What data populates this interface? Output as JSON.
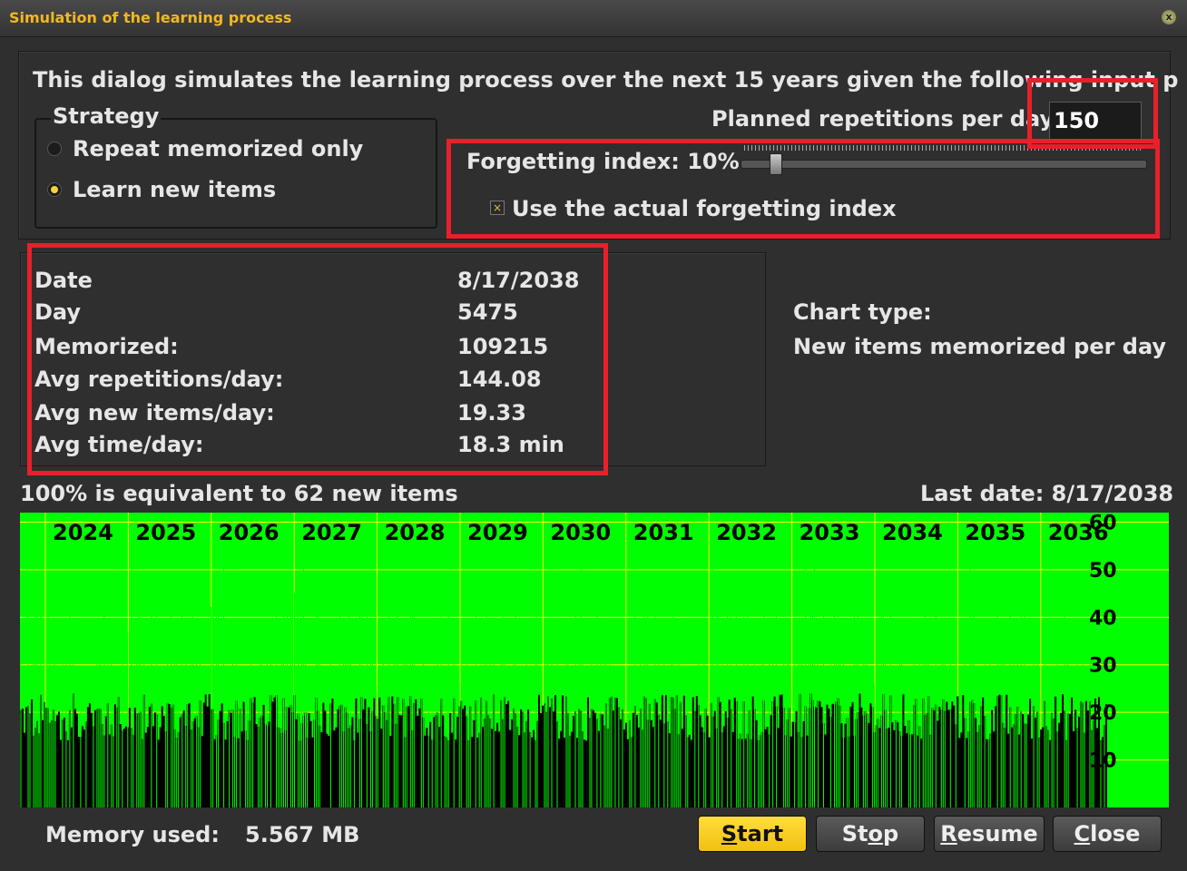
{
  "window": {
    "title": "Simulation of the learning process",
    "close_glyph": "x"
  },
  "intro_text": "This dialog simulates the learning process over the next 15 years given the following input paramete",
  "strategy": {
    "legend": "Strategy",
    "options": [
      {
        "label": "Repeat memorized only",
        "selected": false
      },
      {
        "label": "Learn new items",
        "selected": true
      }
    ]
  },
  "planned": {
    "label": "Planned repetitions per day:",
    "value": "150"
  },
  "forgetting": {
    "label": "Forgetting index: 10%",
    "value_percent": 10,
    "checkbox_label": "Use the actual forgetting index",
    "checkbox_checked": true
  },
  "stats": [
    {
      "label": "Date",
      "value": "8/17/2038"
    },
    {
      "label": "Day",
      "value": "5475"
    },
    {
      "label": "Memorized:",
      "value": "109215"
    },
    {
      "label": "Avg repetitions/day:",
      "value": "144.08"
    },
    {
      "label": "Avg new items/day:",
      "value": "19.33"
    },
    {
      "label": "Avg time/day:",
      "value": "18.3 min"
    }
  ],
  "chart_type": {
    "label": "Chart type:",
    "value": "New items memorized per day"
  },
  "chart_caption": "100% is equivalent to 62 new items",
  "last_date": "Last date: 8/17/2038",
  "chart_data": {
    "type": "bar",
    "years": [
      "2024",
      "2025",
      "2026",
      "2027",
      "2028",
      "2029",
      "2030",
      "2031",
      "2032",
      "2033",
      "2034",
      "2035",
      "2036"
    ],
    "y_ticks": [
      "60",
      "50",
      "40",
      "30",
      "20",
      "10"
    ],
    "ylim": [
      0,
      62
    ],
    "approx_days": 5475,
    "typical_value": 19.33,
    "colors": {
      "background": "#00ff00",
      "bars": "#000000",
      "spikes": "#00ff00",
      "grid": "#ffff00",
      "labels": "#000000"
    }
  },
  "footer": {
    "memory_label": "Memory used:",
    "memory_value": "5.567 MB",
    "buttons": [
      {
        "label": "Start",
        "mnemonic": "S"
      },
      {
        "label": "Stop",
        "mnemonic": "o"
      },
      {
        "label": "Resume",
        "mnemonic": "R"
      },
      {
        "label": "Close",
        "mnemonic": "C"
      }
    ]
  },
  "highlight_color": "#e8202a"
}
